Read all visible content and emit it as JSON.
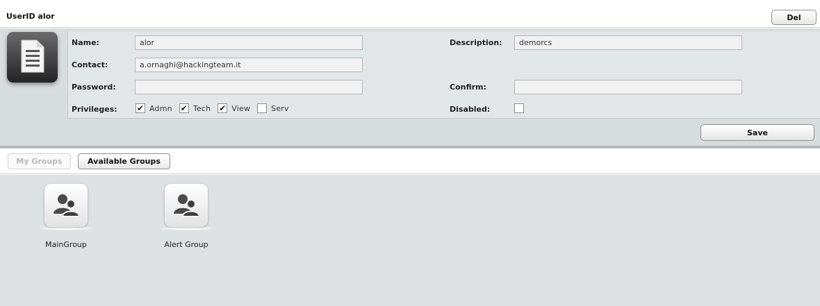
{
  "header": {
    "title": "UserID alor",
    "del_label": "Del"
  },
  "form": {
    "name_label": "Name:",
    "name_value": "alor",
    "description_label": "Description:",
    "description_value": "demorcs",
    "contact_label": "Contact:",
    "contact_value": "a.ornaghi@hackingteam.it",
    "password_label": "Password:",
    "password_value": "",
    "confirm_label": "Confirm:",
    "confirm_value": "",
    "privileges_label": "Privileges:",
    "privileges": [
      {
        "label": "Admn",
        "checked": true
      },
      {
        "label": "Tech",
        "checked": true
      },
      {
        "label": "View",
        "checked": true
      },
      {
        "label": "Serv",
        "checked": false
      }
    ],
    "disabled_label": "Disabled:",
    "disabled_checked": false,
    "save_label": "Save",
    "user_icon": "document-icon"
  },
  "tabs": [
    {
      "label": "My Groups",
      "active": false
    },
    {
      "label": "Available Groups",
      "active": true
    }
  ],
  "groups": [
    {
      "label": "MainGroup",
      "icon": "group-icon"
    },
    {
      "label": "Alert Group",
      "icon": "group-icon"
    }
  ],
  "colors": {
    "panel_bg": "#d7dcdd",
    "form_bg": "#e3e6e7",
    "groups_bg": "#dde1e2"
  }
}
